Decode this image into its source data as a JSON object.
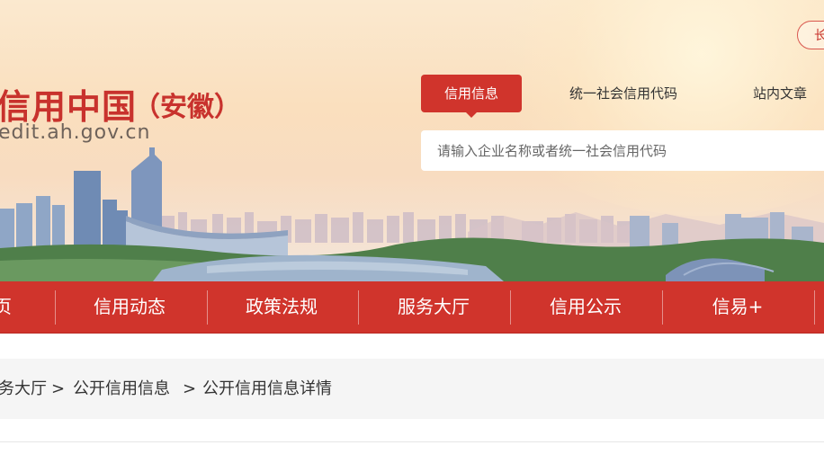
{
  "header": {
    "logo_title": "信用中国",
    "logo_region": "（安徽）",
    "logo_url": "edit.ah.gov.cn",
    "top_button": "长"
  },
  "search": {
    "tabs": [
      {
        "label": "信用信息",
        "active": true
      },
      {
        "label": "统一社会信用代码",
        "active": false
      },
      {
        "label": "站内文章",
        "active": false
      }
    ],
    "placeholder": "请输入企业名称或者统一社会信用代码"
  },
  "nav": {
    "items": [
      {
        "label": "页"
      },
      {
        "label": "信用动态"
      },
      {
        "label": "政策法规"
      },
      {
        "label": "服务大厅"
      },
      {
        "label": "信用公示"
      },
      {
        "label": "信易+"
      }
    ]
  },
  "breadcrumb": {
    "items": [
      {
        "label": "务大厅"
      },
      {
        "label": "公开信用信息"
      },
      {
        "label": "公开信用信息详情"
      }
    ],
    "separator": ">"
  },
  "colors": {
    "brand_red": "#d0342c",
    "breadcrumb_bg": "#f5f5f5"
  }
}
